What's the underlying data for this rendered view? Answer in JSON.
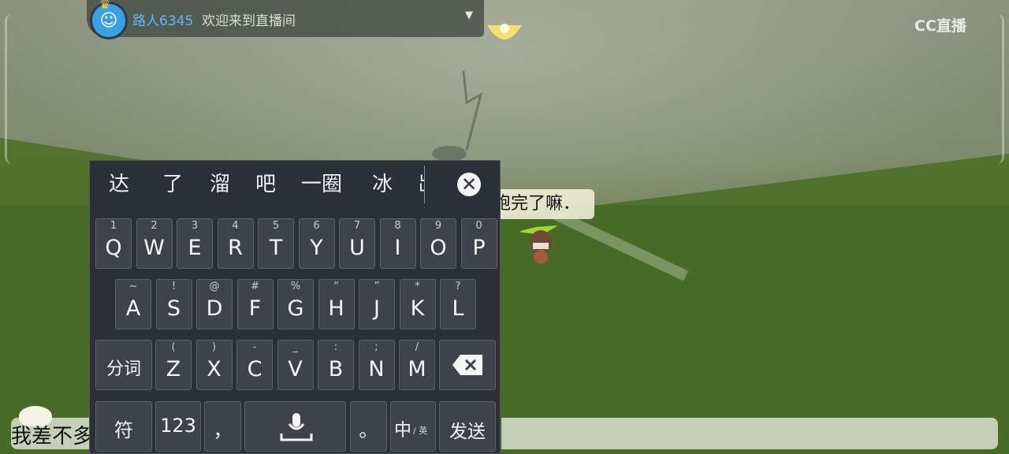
{
  "welcome": {
    "username": "路人6345",
    "message": "欢迎来到直播间",
    "caret": "▼"
  },
  "logo": {
    "text": "CC直播"
  },
  "chat_bubble": {
    "text": "跑完了嘛．"
  },
  "candidates": [
    "达",
    "了",
    "溜",
    "吧",
    "一圈",
    "冰",
    "岀"
  ],
  "keyboard": {
    "row1": [
      {
        "main": "Q",
        "sub": "1"
      },
      {
        "main": "W",
        "sub": "2"
      },
      {
        "main": "E",
        "sub": "3"
      },
      {
        "main": "R",
        "sub": "4"
      },
      {
        "main": "T",
        "sub": "5"
      },
      {
        "main": "Y",
        "sub": "6"
      },
      {
        "main": "U",
        "sub": "7"
      },
      {
        "main": "I",
        "sub": "8"
      },
      {
        "main": "O",
        "sub": "9"
      },
      {
        "main": "P",
        "sub": "0"
      }
    ],
    "row2": [
      {
        "main": "A",
        "sub": "~"
      },
      {
        "main": "S",
        "sub": "!"
      },
      {
        "main": "D",
        "sub": "@"
      },
      {
        "main": "F",
        "sub": "#"
      },
      {
        "main": "G",
        "sub": "%"
      },
      {
        "main": "H",
        "sub": "“"
      },
      {
        "main": "J",
        "sub": "”"
      },
      {
        "main": "K",
        "sub": "*"
      },
      {
        "main": "L",
        "sub": "?"
      }
    ],
    "row3": [
      {
        "main": "Z",
        "sub": "("
      },
      {
        "main": "X",
        "sub": ")"
      },
      {
        "main": "C",
        "sub": "-"
      },
      {
        "main": "V",
        "sub": "_"
      },
      {
        "main": "B",
        "sub": ":"
      },
      {
        "main": "N",
        "sub": ";"
      },
      {
        "main": "M",
        "sub": "/"
      }
    ],
    "segment_label": "分词",
    "symbol_label": "符",
    "number_label": "123",
    "comma_label": "，",
    "period_label": "。",
    "lang_label": "中",
    "lang_sub": "/ 英",
    "send_label": "发送"
  },
  "input": {
    "text": "我差不多"
  }
}
